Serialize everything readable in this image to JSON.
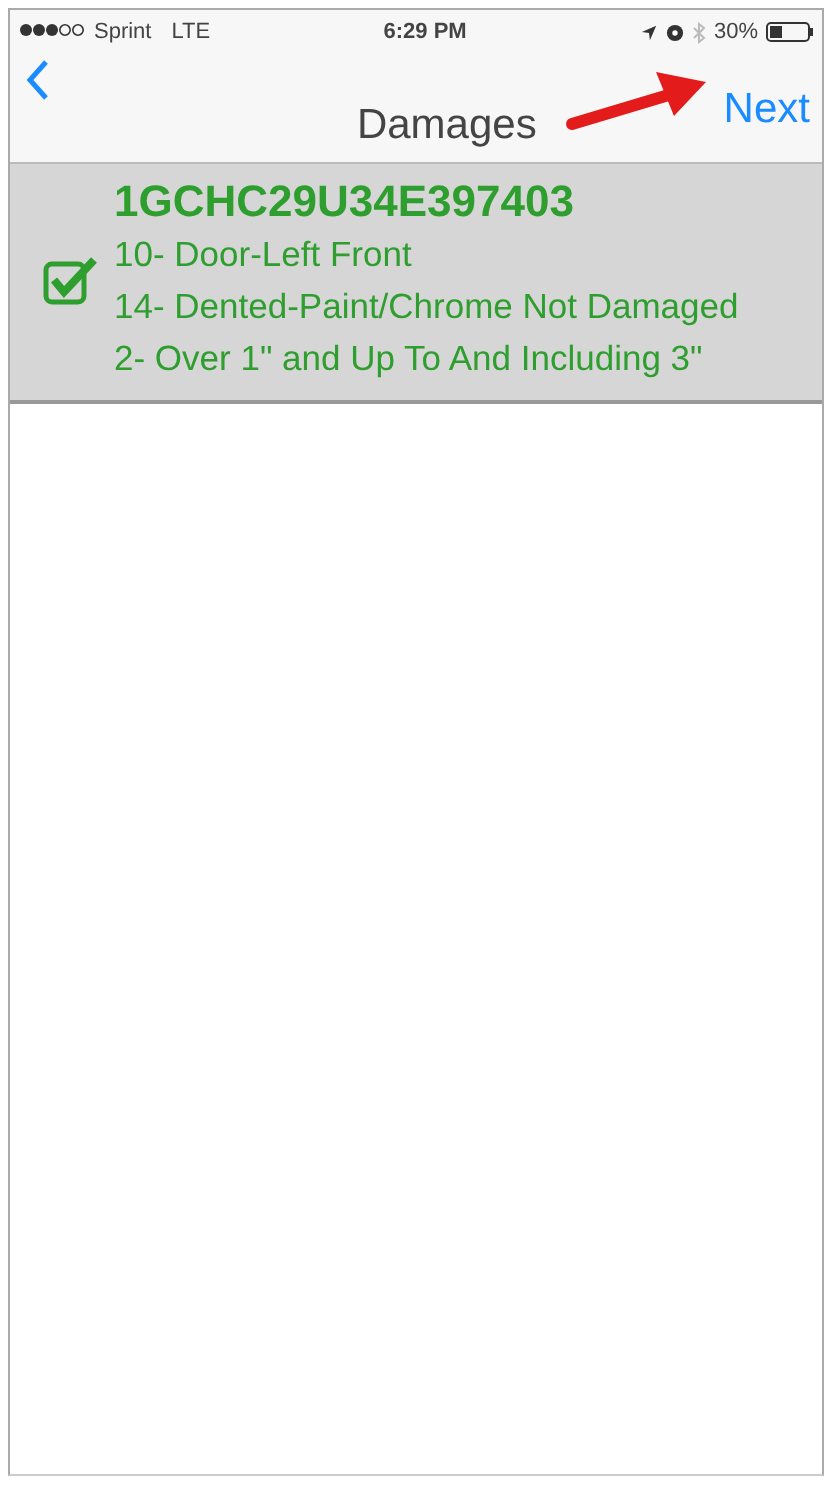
{
  "status_bar": {
    "carrier": "Sprint",
    "network": "LTE",
    "time": "6:29 PM",
    "battery": "30%"
  },
  "nav": {
    "title": "Damages",
    "action": "Next"
  },
  "items": [
    {
      "vin": "1GCHC29U34E397403",
      "checked": true,
      "lines": [
        "10- Door-Left Front",
        "14- Dented-Paint/Chrome Not Damaged",
        "2- Over 1\" and Up To And Including 3\""
      ]
    }
  ]
}
